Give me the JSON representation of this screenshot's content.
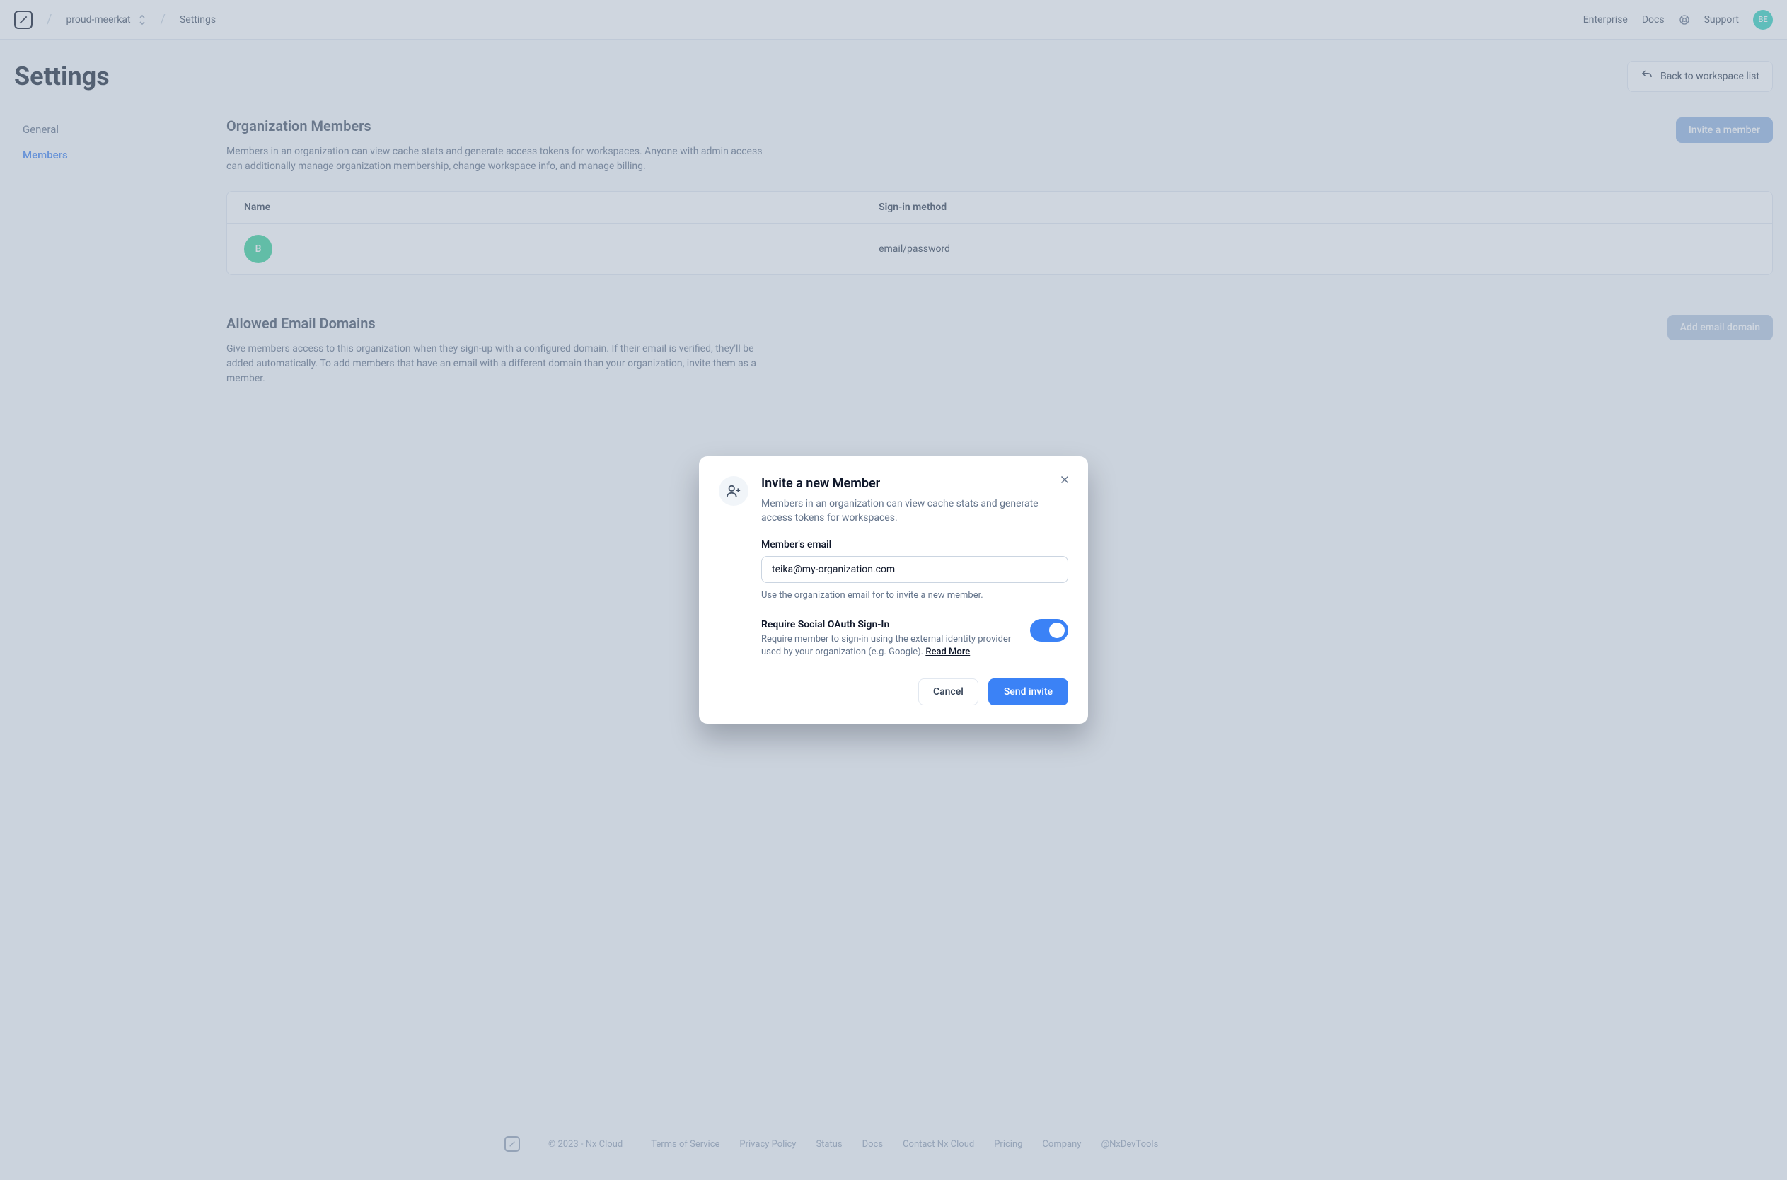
{
  "header": {
    "project": "proud-meerkat",
    "crumb_page": "Settings",
    "links": {
      "enterprise": "Enterprise",
      "docs": "Docs",
      "support": "Support"
    },
    "avatar": "BE"
  },
  "page": {
    "title": "Settings",
    "back_label": "Back to workspace list"
  },
  "sidebar": {
    "items": [
      {
        "label": "General",
        "active": false
      },
      {
        "label": "Members",
        "active": true
      }
    ]
  },
  "sections": {
    "members": {
      "title": "Organization Members",
      "desc": "Members in an organization can view cache stats and generate access tokens for workspaces. Anyone with admin access can additionally manage organization membership, change workspace info, and manage billing.",
      "invite_button": "Invite a member",
      "columns": {
        "name": "Name",
        "signin": "Sign-in method"
      },
      "rows": [
        {
          "avatar": "B",
          "signin": "email/password"
        }
      ]
    },
    "domains": {
      "title": "Allowed Email Domains",
      "desc": "Give members access to this organization when they sign-up with a configured domain. If their email is verified, they'll be added automatically. To add members that have an email with a different domain than your organization, invite them as a member.",
      "add_button": "Add email domain"
    }
  },
  "footer": {
    "copyright": "© 2023 - Nx Cloud",
    "links": [
      "Terms of Service",
      "Privacy Policy",
      "Status",
      "Docs",
      "Contact Nx Cloud",
      "Pricing",
      "Company",
      "@NxDevTools"
    ]
  },
  "modal": {
    "title": "Invite a new Member",
    "subtitle": "Members in an organization can view cache stats and generate access tokens for workspaces.",
    "email_label": "Member's email",
    "email_value": "teika@my-organization.com",
    "email_hint": "Use the organization email for to invite a new member.",
    "oauth_title": "Require Social OAuth Sign-In",
    "oauth_desc": "Require member to sign-in using the external identity provider used by your organization (e.g. Google). ",
    "read_more": "Read More",
    "cancel": "Cancel",
    "send": "Send invite"
  }
}
